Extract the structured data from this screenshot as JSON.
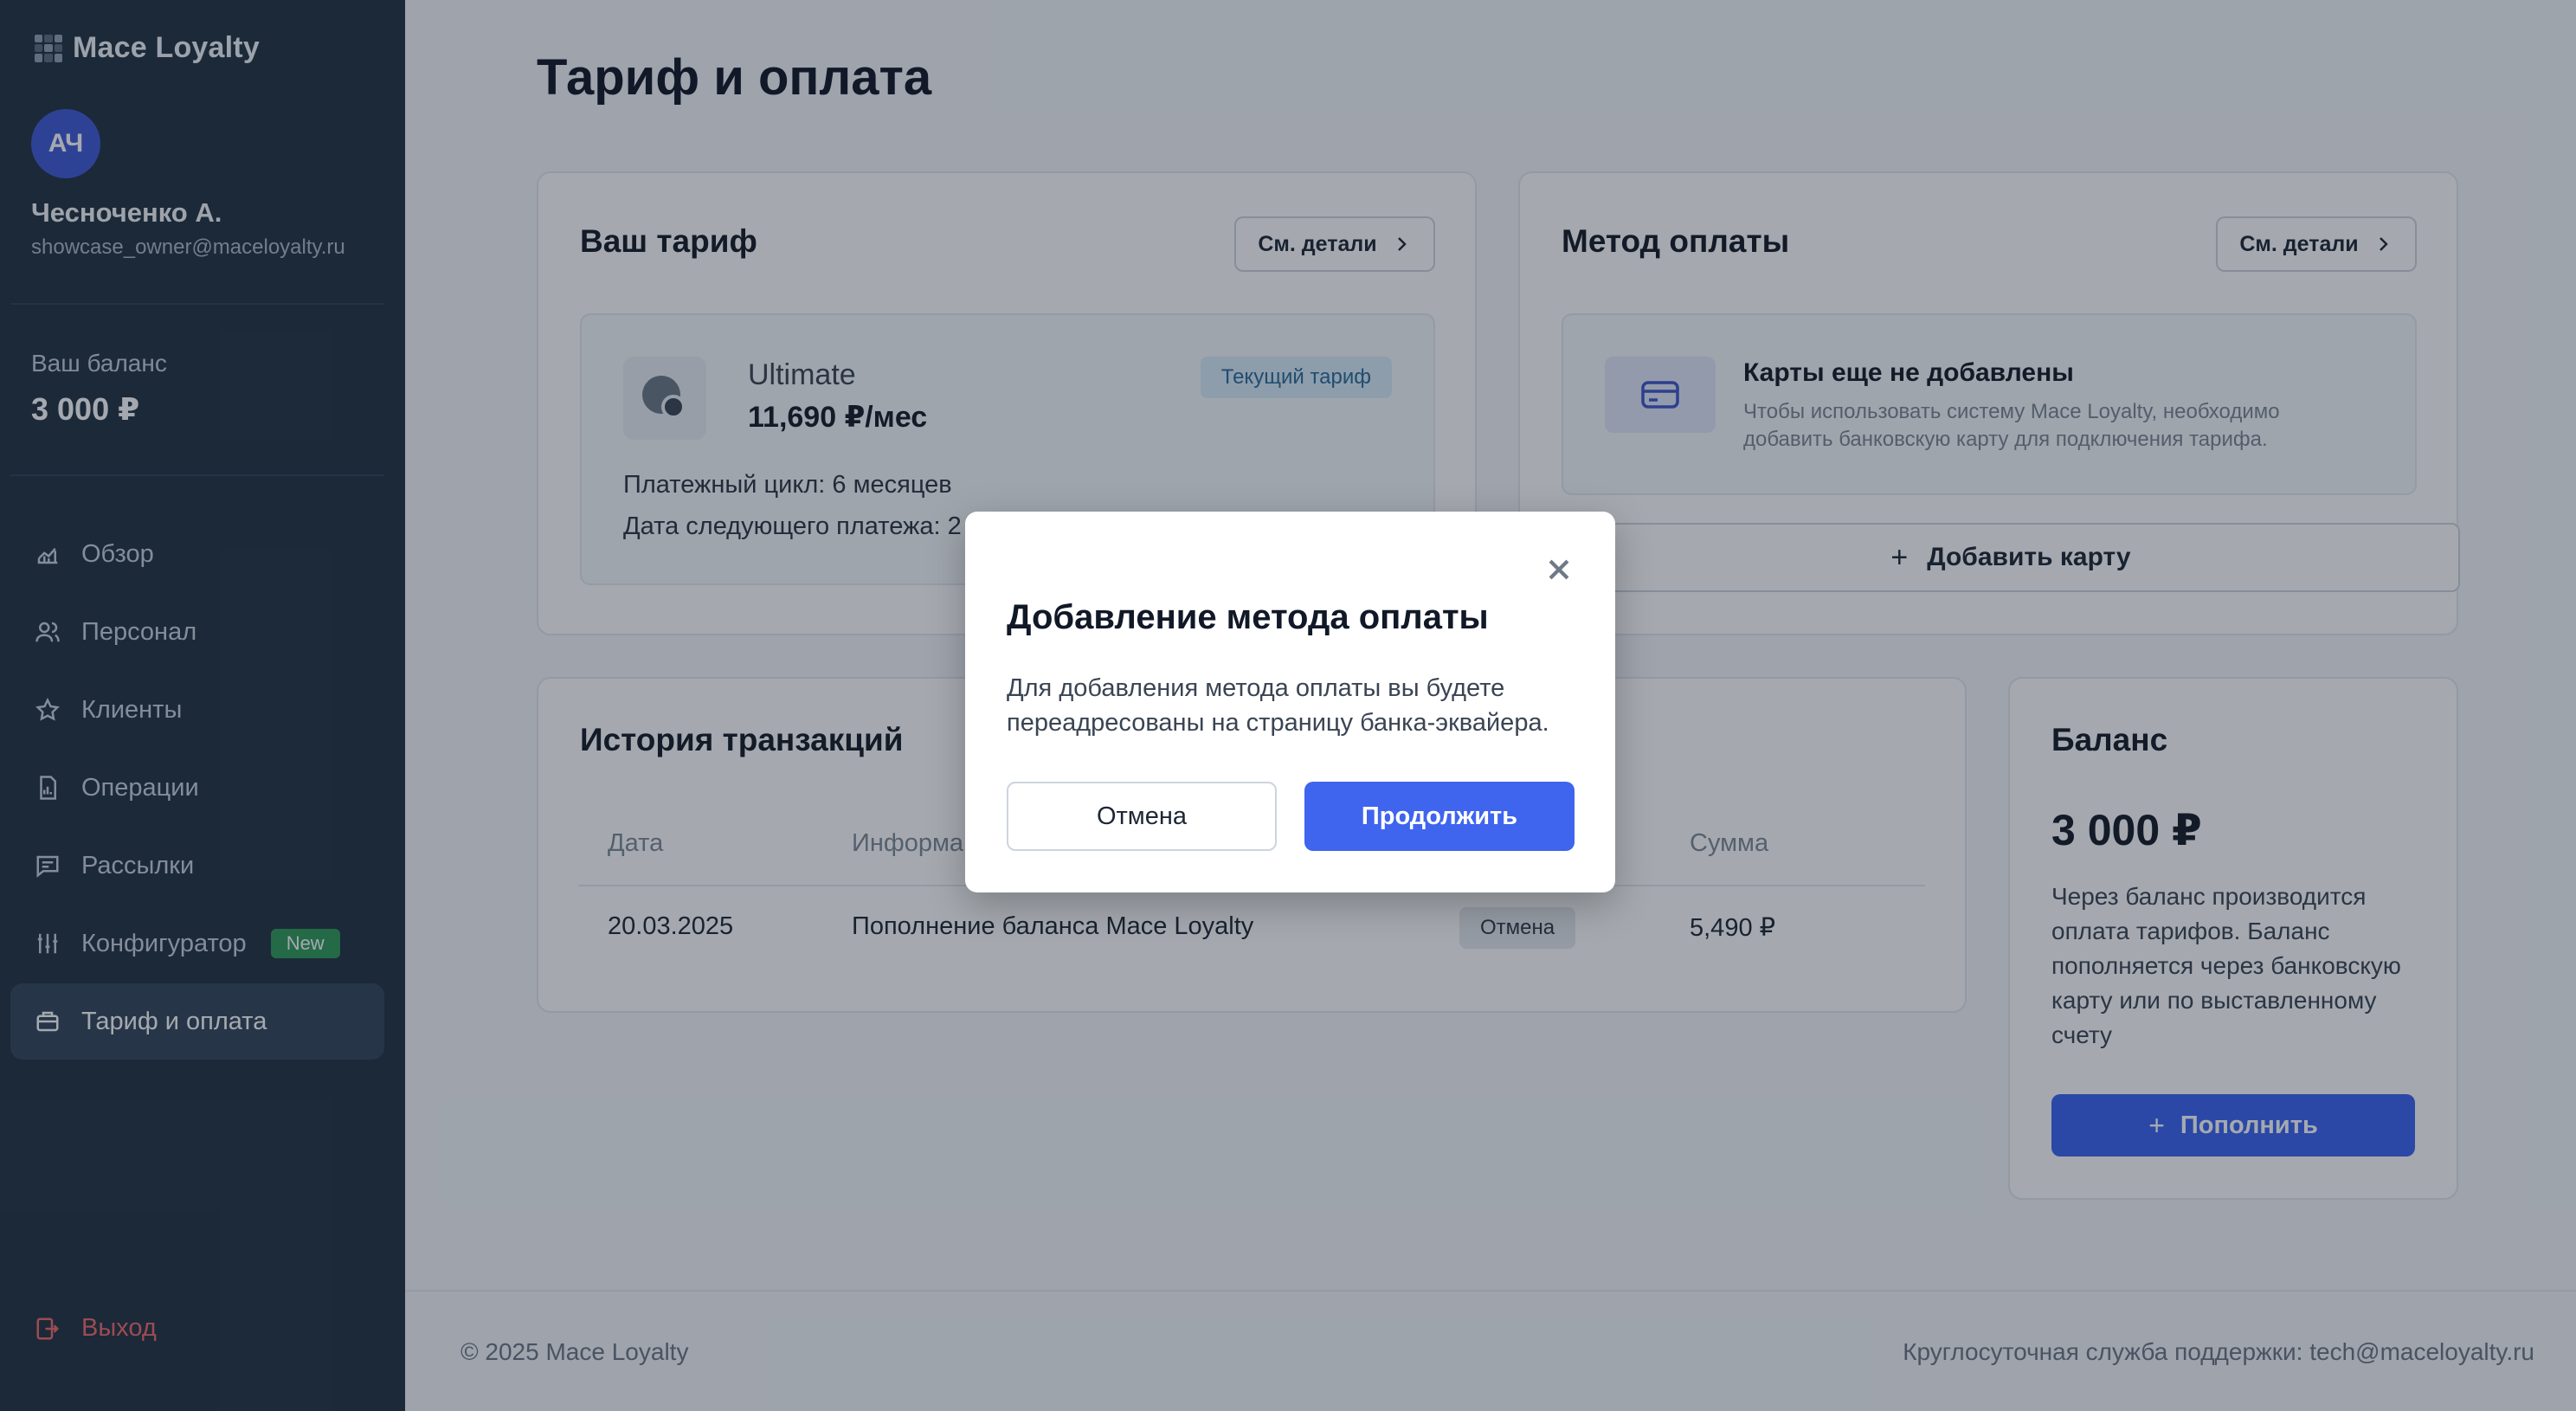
{
  "app": {
    "logo": "Mace Loyalty"
  },
  "user": {
    "initials": "АЧ",
    "name": "Чесноченко А.",
    "email": "showcase_owner@maceloyalty.ru"
  },
  "sidebar_balance": {
    "label": "Ваш баланс",
    "value": "3 000 ₽"
  },
  "nav": {
    "items": [
      {
        "label": "Обзор",
        "icon": "chart-icon"
      },
      {
        "label": "Персонал",
        "icon": "users-icon"
      },
      {
        "label": "Клиенты",
        "icon": "star-icon"
      },
      {
        "label": "Операции",
        "icon": "document-icon"
      },
      {
        "label": "Рассылки",
        "icon": "message-icon"
      },
      {
        "label": "Конфигуратор",
        "icon": "sliders-icon",
        "badge": "New"
      },
      {
        "label": "Тариф и оплата",
        "icon": "briefcase-icon",
        "active": true
      }
    ],
    "logout": "Выход"
  },
  "page": {
    "title": "Тариф и оплата"
  },
  "tariff": {
    "title": "Ваш тариф",
    "details_button": "См. детали",
    "plan_name": "Ultimate",
    "plan_price": "11,690 ₽/мес",
    "current_badge": "Текущий тариф",
    "cycle": "Платежный цикл: 6 месяцев",
    "next_payment": "Дата следующего платежа: 2"
  },
  "payment_method": {
    "title": "Метод оплаты",
    "details_button": "См. детали",
    "empty_title": "Карты еще не добавлены",
    "empty_text": "Чтобы использовать систему Mace Loyalty, необходимо добавить банковскую карту для подключения тарифа.",
    "add_card": "Добавить карту"
  },
  "transactions": {
    "title": "История транзакций",
    "columns": [
      "Дата",
      "Информа",
      "Сумма"
    ],
    "rows": [
      {
        "date": "20.03.2025",
        "info": "Пополнение баланса Mace Loyalty",
        "status": "Отмена",
        "amount": "5,490 ₽"
      }
    ]
  },
  "balance": {
    "title": "Баланс",
    "value": "3 000 ₽",
    "description": "Через баланс производится оплата тарифов. Баланс пополняется через банковскую карту или по выставленному счету",
    "topup": "Пополнить"
  },
  "footer": {
    "copyright": "© 2025 Mace Loyalty",
    "support": "Круглосуточная служба поддержки: tech@maceloyalty.ru"
  },
  "modal": {
    "title": "Добавление метода оплаты",
    "text": "Для добавления метода оплаты вы будете переадресованы на страницу банка-эквайера.",
    "cancel": "Отмена",
    "continue": "Продолжить"
  },
  "colors": {
    "sidebar": "#223142",
    "accent": "#3f64ee",
    "badge_new": "#2f9a58",
    "logout": "#ef6a6a"
  }
}
